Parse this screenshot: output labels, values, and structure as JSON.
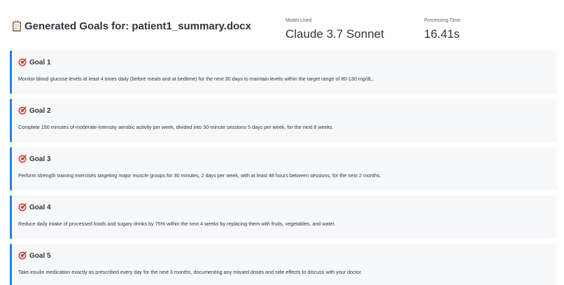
{
  "header": {
    "title": "Generated Goals for: patient1_summary.docx",
    "title_icon": "clipboard-icon"
  },
  "metrics": {
    "model": {
      "label": "Model Used",
      "value": "Claude 3.7 Sonnet"
    },
    "time": {
      "label": "Processing Time",
      "value": "16.41s"
    }
  },
  "goals": [
    {
      "icon": "target-icon",
      "title": "Goal 1",
      "text": "Monitor blood glucose levels at least 4 times daily (before meals and at bedtime) for the next 30 days to maintain levels within the target range of 80-130 mg/dL."
    },
    {
      "icon": "target-icon",
      "title": "Goal 2",
      "text": "Complete 150 minutes of moderate-intensity aerobic activity per week, divided into 30-minute sessions 5 days per week, for the next 8 weeks."
    },
    {
      "icon": "target-icon",
      "title": "Goal 3",
      "text": "Perform strength training exercises targeting major muscle groups for 30 minutes, 2 days per week, with at least 48 hours between sessions, for the next 2 months."
    },
    {
      "icon": "target-icon",
      "title": "Goal 4",
      "text": "Reduce daily intake of processed foods and sugary drinks by 75% within the next 4 weeks by replacing them with fruits, vegetables, and water."
    },
    {
      "icon": "target-icon",
      "title": "Goal 5",
      "text": "Take insulin medication exactly as prescribed every day for the next 3 months, documenting any missed doses and side effects to discuss with your doctor."
    }
  ],
  "colors": {
    "accent": "#1c83e1",
    "card_bg": "#f7f8fa",
    "target_red": "#e0443b"
  }
}
